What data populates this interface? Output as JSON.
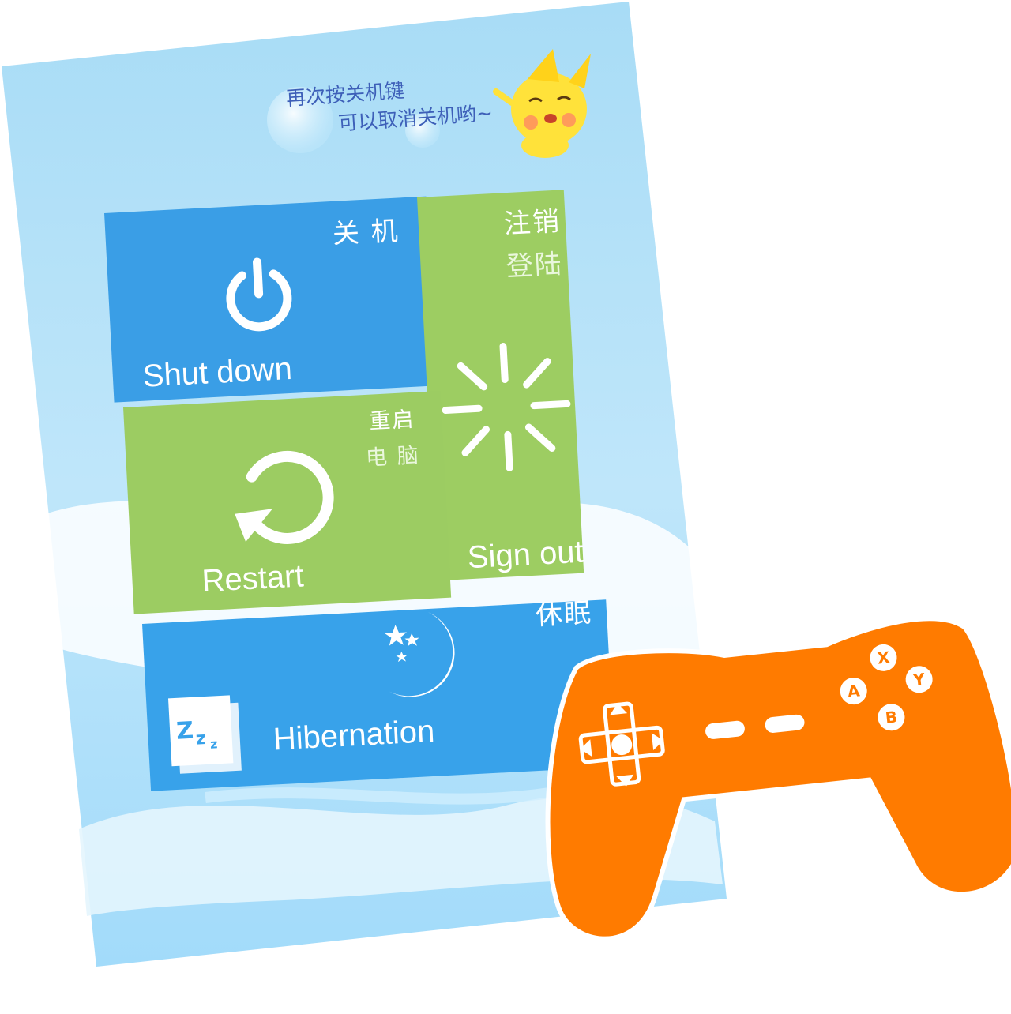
{
  "hint": {
    "line1": "再次按关机键",
    "line2": "可以取消关机哟~"
  },
  "tiles": {
    "shutdown": {
      "zh": "关 机",
      "en": "Shut down",
      "color": "#3a9ee6"
    },
    "signout": {
      "zh_line1": "注销",
      "zh_line2": "登陆",
      "en": "Sign out",
      "color": "#9dcd62"
    },
    "restart": {
      "zh_line1": "重启",
      "zh_line2": "电 脑",
      "en": "Restart",
      "color": "#9ccc62"
    },
    "hibernation": {
      "zh": "休眠",
      "en": "Hibernation",
      "color": "#38a2ea"
    }
  },
  "icons": {
    "power": "power-icon",
    "restart": "restart-icon",
    "loading": "loading-spinner-icon",
    "moon": "moon-stars-icon",
    "sleep": "zzz-sleep-icon",
    "gamepad": "gamepad-icon"
  },
  "gamepad": {
    "color": "#ff7b00",
    "buttons": [
      "X",
      "A",
      "Y",
      "B"
    ]
  },
  "colors": {
    "sky": "#a7dcf6",
    "white": "#ffffff"
  }
}
